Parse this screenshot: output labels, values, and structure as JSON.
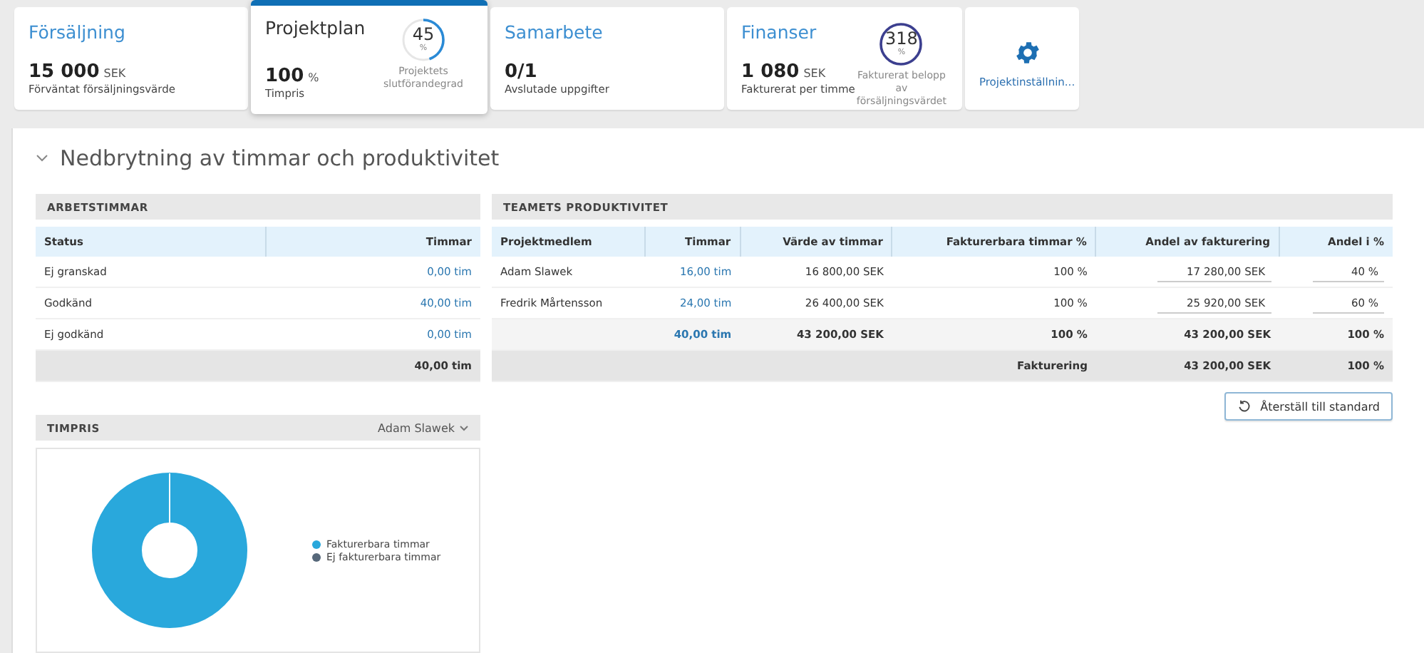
{
  "cards": [
    {
      "kind": "plain",
      "title": "Försäljning",
      "value": "15 000",
      "unit": "SEK",
      "caption": "Förväntat försäljningsvärde",
      "selected": false
    },
    {
      "kind": "gauge",
      "title": "Projektplan",
      "value": "100",
      "unit": "%",
      "caption": "Timpris",
      "gauge": {
        "number": "45",
        "unit": "%",
        "label": "Projektets slutförandegrad"
      },
      "selected": true
    },
    {
      "kind": "plain",
      "title": "Samarbete",
      "value": "0/1",
      "caption": "Avslutade uppgifter",
      "selected": false
    },
    {
      "kind": "gauge",
      "title": "Finanser",
      "value": "1 080",
      "unit": "SEK",
      "caption": "Fakturerat per timme",
      "gauge": {
        "number": "318",
        "unit": "%",
        "label": "Fakturerat belopp av försäljningsvärdet"
      },
      "selected": false
    },
    {
      "kind": "settings",
      "caption": "Projektinställnin...",
      "selected": false
    }
  ],
  "section": {
    "title": "Nedbrytning av timmar och produktivitet",
    "expanded": true
  },
  "hours": {
    "title": "ARBETSTIMMAR",
    "columns": [
      "Status",
      "Timmar"
    ],
    "rows": [
      {
        "status": "Ej granskad",
        "hours": "0,00 tim"
      },
      {
        "status": "Godkänd",
        "hours": "40,00 tim"
      },
      {
        "status": "Ej godkänd",
        "hours": "0,00 tim"
      }
    ],
    "total": "40,00 tim"
  },
  "rate": {
    "title": "TIMPRIS",
    "member": "Adam Slawek",
    "legend": [
      {
        "label": "Fakturerbara timmar",
        "color": "#29a8dc"
      },
      {
        "label": "Ej fakturerbara timmar",
        "color": "#56687a"
      }
    ]
  },
  "productivity": {
    "title": "TEAMETS PRODUKTIVITET",
    "columns": [
      "Projektmedlem",
      "Timmar",
      "Värde av timmar",
      "Fakturerbara timmar %",
      "Andel av fakturering",
      "Andel i %"
    ],
    "rows": [
      {
        "member": "Adam Slawek",
        "hours": "16,00 tim",
        "value": "16 800,00 SEK",
        "billable": "100 %",
        "share": "17 280,00 SEK",
        "percent": "40 %"
      },
      {
        "member": "Fredrik Mårtensson",
        "hours": "24,00 tim",
        "value": "26 400,00 SEK",
        "billable": "100 %",
        "share": "25 920,00 SEK",
        "percent": "60 %"
      }
    ],
    "total": {
      "hours": "40,00 tim",
      "value": "43 200,00 SEK",
      "billable": "100 %",
      "share": "43 200,00 SEK",
      "percent": "100 %"
    },
    "billing": {
      "label": "Fakturering",
      "share": "43 200,00 SEK",
      "percent": "100 %"
    },
    "reset_button": "Återställ till standard"
  }
}
